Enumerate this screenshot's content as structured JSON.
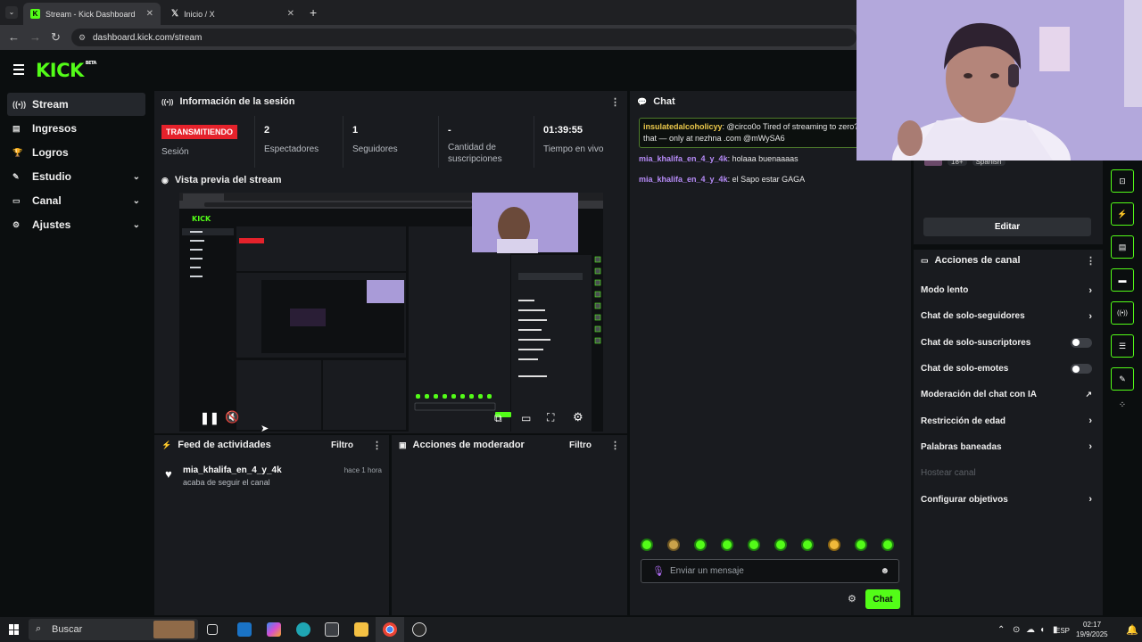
{
  "browser": {
    "tabs": [
      {
        "title": "Stream - Kick Dashboard",
        "favicon": "kick-logo"
      },
      {
        "title": "Inicio / X",
        "favicon": "x-logo"
      }
    ],
    "url": "dashboard.kick.com/stream"
  },
  "brand": {
    "logo": "KICK",
    "badge": "BETA",
    "accent": "#53fc18"
  },
  "sidebar": {
    "items": [
      {
        "label": "Stream",
        "icon": "broadcast-icon",
        "active": true
      },
      {
        "label": "Ingresos",
        "icon": "money-icon"
      },
      {
        "label": "Logros",
        "icon": "trophy-icon"
      },
      {
        "label": "Estudio",
        "icon": "wrench-icon",
        "expandable": true
      },
      {
        "label": "Canal",
        "icon": "monitor-icon",
        "expandable": true
      },
      {
        "label": "Ajustes",
        "icon": "gear-icon",
        "expandable": true
      }
    ]
  },
  "session": {
    "title": "Información de la sesión",
    "status_badge": "TRANSMITIENDO",
    "status_label": "Sesión",
    "stats": [
      {
        "value": "2",
        "label": "Espectadores"
      },
      {
        "value": "1",
        "label": "Seguidores"
      },
      {
        "value": "-",
        "label": "Cantidad de suscripciones"
      },
      {
        "value": "01:39:55",
        "label": "Tiempo en vivo"
      }
    ]
  },
  "preview": {
    "title": "Vista previa del stream"
  },
  "activity": {
    "title": "Feed de actividades",
    "filter": "Filtro",
    "items": [
      {
        "user": "mia_khalifa_en_4_y_4k",
        "text": "acaba de seguir el canal",
        "time": "hace 1 hora"
      }
    ]
  },
  "moderator": {
    "title": "Acciones de moderador",
    "filter": "Filtro"
  },
  "chat": {
    "title": "Chat",
    "pinned": {
      "user": "insulatedalcoholicyy",
      "text": "@circo0o Tired of streaming to zero? change that — only at nezhna .com @mWySA6"
    },
    "messages": [
      {
        "user": "mia_khalifa_en_4_y_4k",
        "text": "holaaa buenaaaas"
      },
      {
        "user": "mia_khalifa_en_4_y_4k",
        "text": "el Sapo estar GAGA"
      }
    ],
    "input_placeholder": "Enviar un mensaje",
    "send_label": "Chat"
  },
  "channel": {
    "tags": [
      "18+",
      "Spanish"
    ],
    "edit_label": "Editar",
    "actions_title": "Acciones de canal",
    "actions": [
      {
        "label": "Modo lento",
        "control": "chevron"
      },
      {
        "label": "Chat de solo-seguidores",
        "control": "chevron"
      },
      {
        "label": "Chat de solo-suscriptores",
        "control": "toggle"
      },
      {
        "label": "Chat de solo-emotes",
        "control": "toggle"
      },
      {
        "label": "Moderación del chat con IA",
        "control": "external"
      },
      {
        "label": "Restricción de edad",
        "control": "chevron"
      },
      {
        "label": "Palabras baneadas",
        "control": "chevron"
      },
      {
        "label": "Hostear canal",
        "control": "none",
        "disabled": true
      },
      {
        "label": "Configurar objetivos",
        "control": "chevron"
      }
    ]
  },
  "taskbar": {
    "search_placeholder": "Buscar",
    "lang": "ESP",
    "time": "02:17",
    "date": "19/9/2025"
  }
}
